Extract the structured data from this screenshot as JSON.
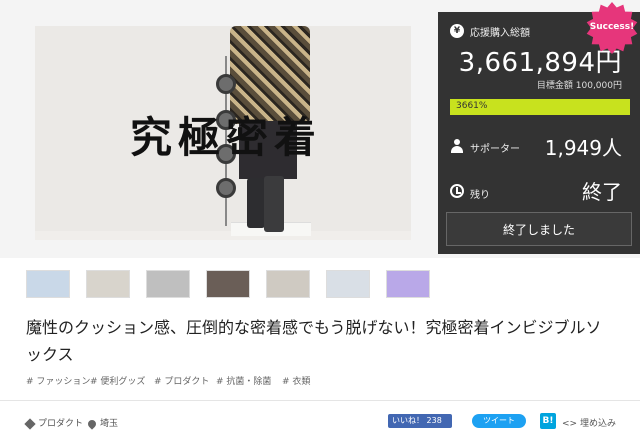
{
  "hero": {
    "title": "究極密着"
  },
  "funding": {
    "yen_icon": "¥",
    "total_label": "応援購入総額",
    "amount": "3,661,894円",
    "goal_text": "目標金額 100,000円",
    "percent_text": "3661%",
    "percent_value": 3661,
    "supporters_label": "サポーター",
    "supporters": "1,949人",
    "remaining_label": "残り",
    "remaining": "終了",
    "ended_button": "終了しました",
    "badge": "Success!",
    "accent": "#c8e21e",
    "badge_color": "#e6367b"
  },
  "thumbnails": [
    {
      "name": "thumb-1",
      "color": "#c9d8e8"
    },
    {
      "name": "thumb-2",
      "color": "#d8d4cc"
    },
    {
      "name": "thumb-3",
      "color": "#bfbfbf"
    },
    {
      "name": "thumb-4",
      "color": "#6a5e57"
    },
    {
      "name": "thumb-5",
      "color": "#cfcac2"
    },
    {
      "name": "thumb-6",
      "color": "#d9dfe6"
    },
    {
      "name": "thumb-7",
      "color": "#b9a8e8"
    }
  ],
  "project": {
    "title": "魔性のクッション感、圧倒的な密着感でもう脱げない！究極密着インビジブルソックス"
  },
  "tags": [
    "# ファッション",
    "# 便利グッズ",
    "# プロダクト",
    "# 抗菌・除菌",
    "# 衣類"
  ],
  "footer": {
    "category": "プロダクト",
    "location": "埼玉",
    "like_label": "いいね！ 238",
    "tweet_label": "ツイート",
    "hatena_label": "B!",
    "embed_label": "<> 埋め込み"
  }
}
